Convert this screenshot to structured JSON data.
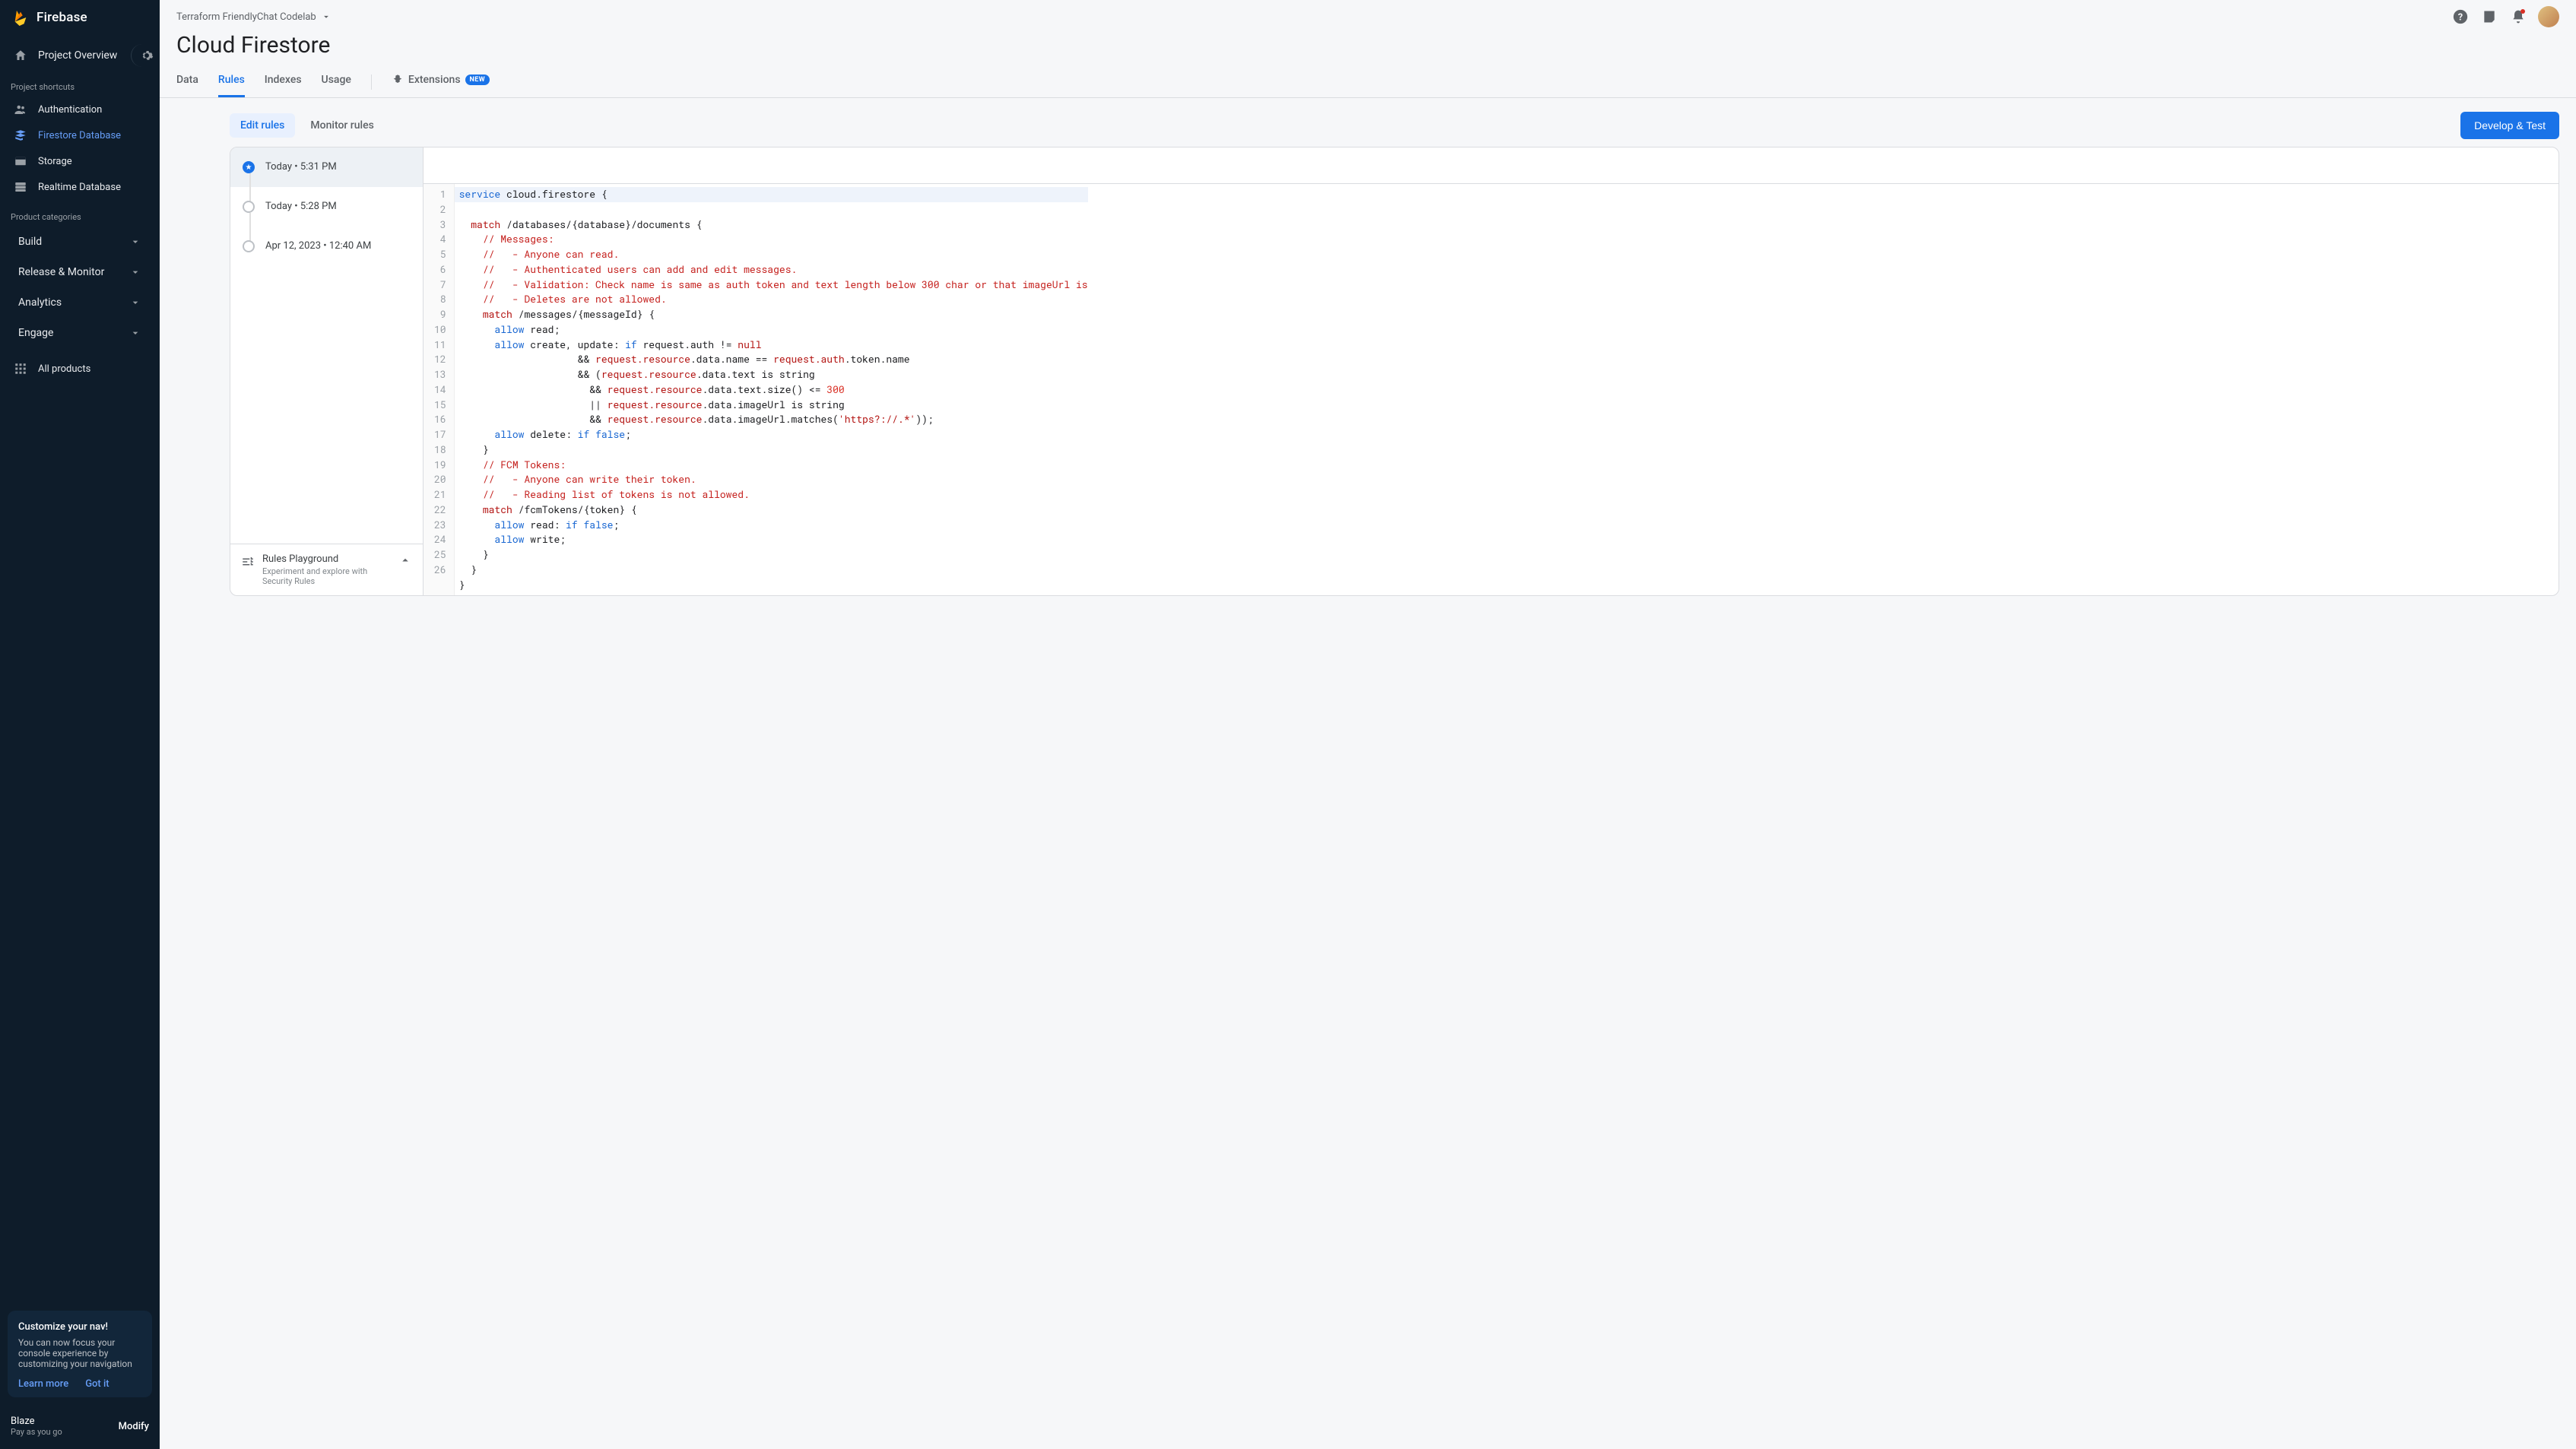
{
  "brand": "Firebase",
  "projectOverview": "Project Overview",
  "projectName": "Terraform FriendlyChat Codelab",
  "pageTitle": "Cloud Firestore",
  "sectionLabels": {
    "shortcuts": "Project shortcuts",
    "categories": "Product categories"
  },
  "shortcuts": [
    {
      "label": "Authentication",
      "icon": "people"
    },
    {
      "label": "Firestore Database",
      "icon": "firestore",
      "active": true
    },
    {
      "label": "Storage",
      "icon": "storage"
    },
    {
      "label": "Realtime Database",
      "icon": "rtdb"
    }
  ],
  "categories": [
    {
      "label": "Build"
    },
    {
      "label": "Release & Monitor"
    },
    {
      "label": "Analytics"
    },
    {
      "label": "Engage"
    }
  ],
  "allProducts": "All products",
  "promo": {
    "title": "Customize your nav!",
    "body": "You can now focus your console experience by customizing your navigation",
    "learn": "Learn more",
    "got": "Got it"
  },
  "plan": {
    "name": "Blaze",
    "sub": "Pay as you go",
    "modify": "Modify"
  },
  "tabs": [
    {
      "label": "Data"
    },
    {
      "label": "Rules",
      "active": true
    },
    {
      "label": "Indexes"
    },
    {
      "label": "Usage"
    }
  ],
  "extensionsTab": "Extensions",
  "newBadge": "NEW",
  "segBtns": {
    "edit": "Edit rules",
    "monitor": "Monitor rules"
  },
  "devTest": "Develop & Test",
  "history": [
    {
      "label": "Today • 5:31 PM",
      "active": true
    },
    {
      "label": "Today • 5:28 PM"
    },
    {
      "label": "Apr 12, 2023 • 12:40 AM"
    }
  ],
  "playground": {
    "title": "Rules Playground",
    "sub": "Experiment and explore with Security Rules"
  },
  "code": {
    "lines": 26,
    "l1a": "service",
    "l1b": " cloud.firestore {",
    "l2a": "match",
    "l2b": " /databases/{database}/documents {",
    "l3": "// Messages:",
    "l4": "//   - Anyone can read.",
    "l5": "//   - Authenticated users can add and edit messages.",
    "l6": "//   - Validation: Check name is same as auth token and text length below 300 char or that imageUrl is",
    "l7": "//   - Deletes are not allowed.",
    "l8a": "match",
    "l8b": " /messages/{messageId} {",
    "l9a": "allow",
    "l9b": " read;",
    "l10a": "allow",
    "l10b": " create, update: ",
    "l10c": "if",
    "l10d": " request.auth != ",
    "l10e": "null",
    "l11a": "&& ",
    "l11b": "request.resource",
    "l11c": ".data.name == ",
    "l11d": "request.auth",
    "l11e": ".token.name",
    "l12a": "&& (",
    "l12b": "request.resource",
    "l12c": ".data.text is string",
    "l13a": "&& ",
    "l13b": "request.resource",
    "l13c": ".data.text.size() <= ",
    "l13d": "300",
    "l14a": "|| ",
    "l14b": "request.resource",
    "l14c": ".data.imageUrl is string",
    "l15a": "&& ",
    "l15b": "request.resource",
    "l15c": ".data.imageUrl.matches(",
    "l15d": "'https?://.*'",
    "l15e": "));",
    "l16a": "allow",
    "l16b": " delete: ",
    "l16c": "if",
    "l16d": " ",
    "l16e": "false",
    "l16f": ";",
    "l17": "}",
    "l18": "// FCM Tokens:",
    "l19": "//   - Anyone can write their token.",
    "l20": "//   - Reading list of tokens is not allowed.",
    "l21a": "match",
    "l21b": " /fcmTokens/{token} {",
    "l22a": "allow",
    "l22b": " read: ",
    "l22c": "if",
    "l22d": " ",
    "l22e": "false",
    "l22f": ";",
    "l23a": "allow",
    "l23b": " write;",
    "l24": "}",
    "l25": "}",
    "l26": "}"
  }
}
